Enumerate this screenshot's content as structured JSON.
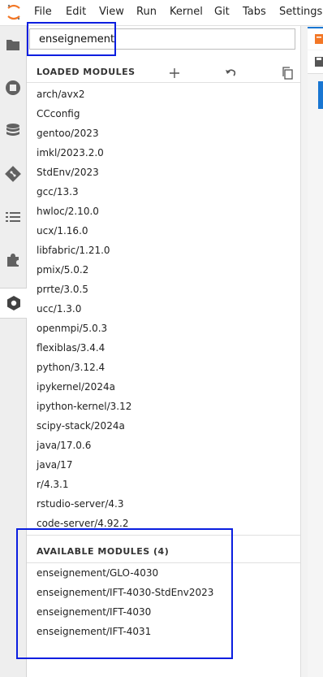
{
  "menu": [
    "File",
    "Edit",
    "View",
    "Run",
    "Kernel",
    "Git",
    "Tabs",
    "Settings"
  ],
  "activity_icons": [
    "folder-icon",
    "running-icon",
    "database-icon",
    "git-icon",
    "list-icon",
    "puzzle-icon",
    "hexagon-icon"
  ],
  "search": {
    "value": "enseignement"
  },
  "loaded": {
    "header": "LOADED MODULES",
    "modules": [
      "arch/avx2",
      "CCconfig",
      "gentoo/2023",
      "imkl/2023.2.0",
      "StdEnv/2023",
      "gcc/13.3",
      "hwloc/2.10.0",
      "ucx/1.16.0",
      "libfabric/1.21.0",
      "pmix/5.0.2",
      "prrte/3.0.5",
      "ucc/1.3.0",
      "openmpi/5.0.3",
      "flexiblas/3.4.4",
      "python/3.12.4",
      "ipykernel/2024a",
      "ipython-kernel/3.12",
      "scipy-stack/2024a",
      "java/17.0.6",
      "java/17",
      "r/4.3.1",
      "rstudio-server/4.3",
      "code-server/4.92.2"
    ]
  },
  "available": {
    "header": "AVAILABLE MODULES (4)",
    "modules": [
      "enseignement/GLO-4030",
      "enseignement/IFT-4030-StdEnv2023",
      "enseignement/IFT-4030",
      "enseignement/IFT-4031"
    ]
  },
  "colors": {
    "accent": "#1976d2",
    "annotation": "#0a1ee0",
    "logo": "#f37726"
  }
}
